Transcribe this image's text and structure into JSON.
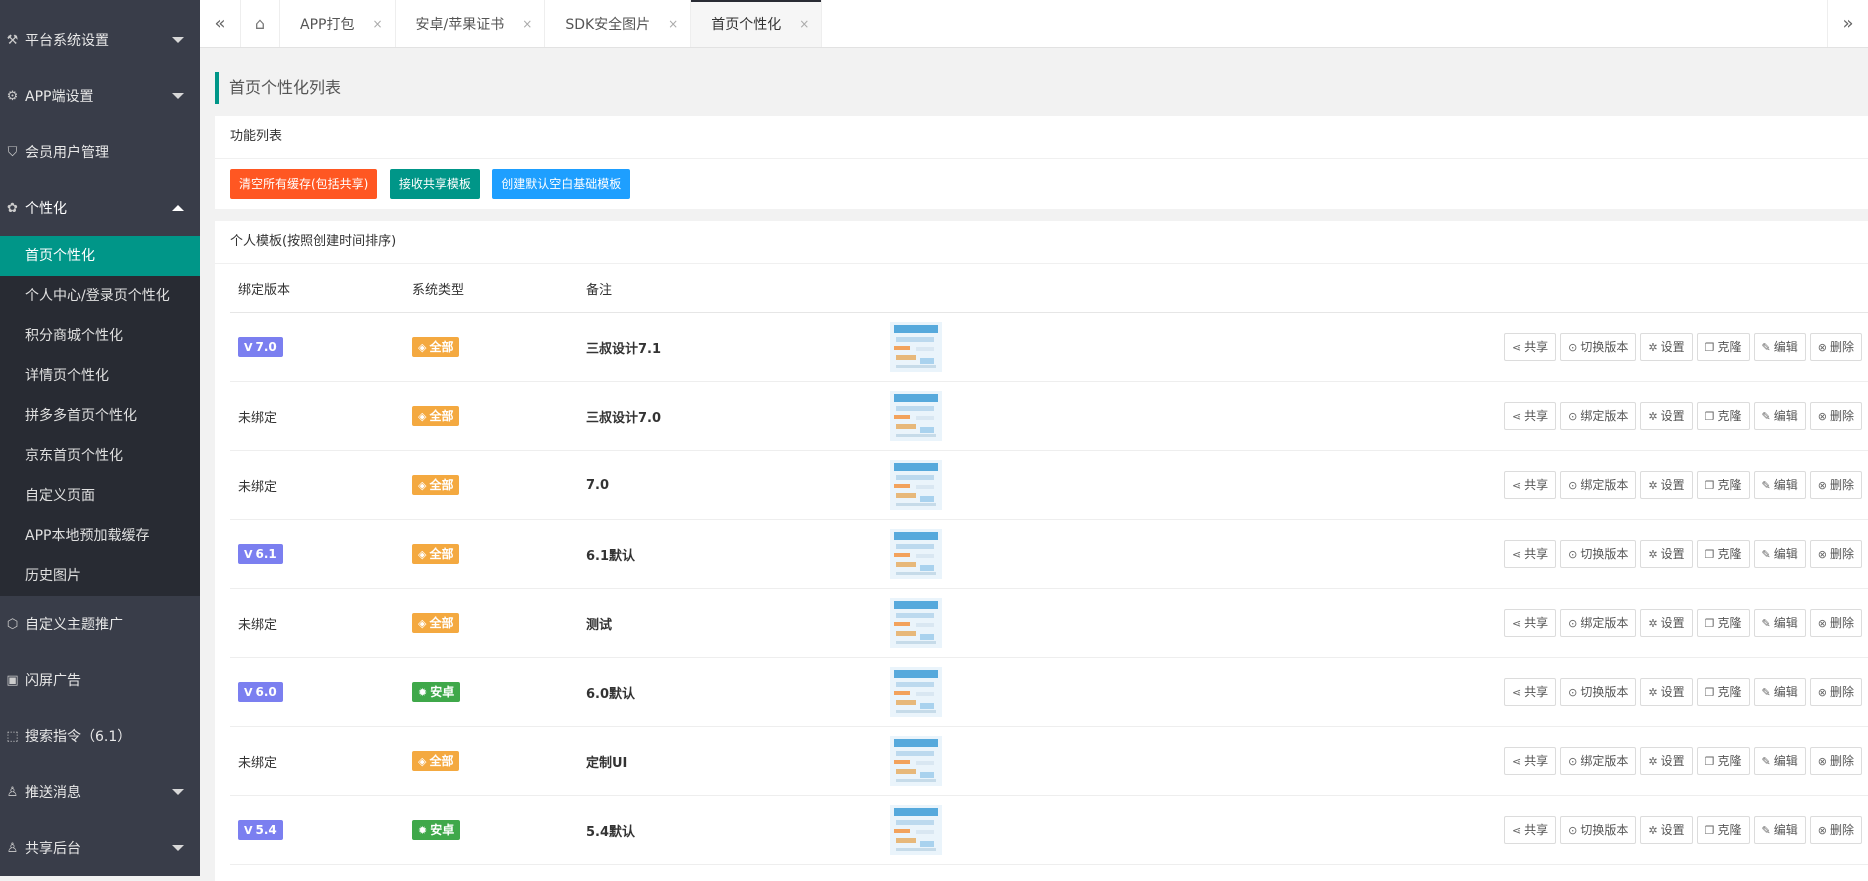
{
  "sidebar": {
    "items": [
      {
        "label": "平台系统设置",
        "icon": "tools-icon",
        "glyph": "⚒",
        "arrow": "down"
      },
      {
        "label": "APP端设置",
        "icon": "gear-icon",
        "glyph": "⚙",
        "arrow": "down"
      },
      {
        "label": "会员用户管理",
        "icon": "shield-icon",
        "glyph": "⛉",
        "arrow": ""
      },
      {
        "label": "个性化",
        "icon": "palette-icon",
        "glyph": "✿",
        "arrow": "up"
      }
    ],
    "subitems": [
      "首页个性化",
      "个人中心/登录页个性化",
      "积分商城个性化",
      "详情页个性化",
      "拼多多首页个性化",
      "京东首页个性化",
      "自定义页面",
      "APP本地预加载缓存",
      "历史图片"
    ],
    "bottom_items": [
      {
        "label": "自定义主题推广",
        "icon": "cube-icon",
        "glyph": "⬡",
        "arrow": ""
      },
      {
        "label": "闪屏广告",
        "icon": "image-icon",
        "glyph": "▣",
        "arrow": ""
      },
      {
        "label": "搜索指令（6.1）",
        "icon": "search-command-icon",
        "glyph": "⬚",
        "arrow": ""
      },
      {
        "label": "推送消息",
        "icon": "user-icon",
        "glyph": "♙",
        "arrow": "down"
      },
      {
        "label": "共享后台",
        "icon": "share-user-icon",
        "glyph": "♙",
        "arrow": "down"
      }
    ]
  },
  "tabs": [
    {
      "label": "APP打包"
    },
    {
      "label": "安卓/苹果证书"
    },
    {
      "label": "SDK安全图片"
    },
    {
      "label": "首页个性化"
    }
  ],
  "tab_close": "×",
  "page_title": "首页个性化列表",
  "functions": {
    "title": "功能列表",
    "buttons": [
      "清空所有缓存(包括共享)",
      "接收共享模板",
      "创建默认空白基础模板"
    ]
  },
  "templates": {
    "title": "个人模板(按照创建时间排序)",
    "columns": [
      "绑定版本",
      "系统类型",
      "备注"
    ],
    "rows": [
      {
        "version": "7.0",
        "system": "全部",
        "note": "三叔设计7.1",
        "switch": "切换版本"
      },
      {
        "version": "未绑定",
        "system": "全部",
        "note": "三叔设计7.0",
        "switch": "绑定版本"
      },
      {
        "version": "未绑定",
        "system": "全部",
        "note": "7.0",
        "switch": "绑定版本"
      },
      {
        "version": "6.1",
        "system": "全部",
        "note": "6.1默认",
        "switch": "切换版本"
      },
      {
        "version": "未绑定",
        "system": "全部",
        "note": "测试",
        "switch": "绑定版本"
      },
      {
        "version": "6.0",
        "system": "安卓",
        "note": "6.0默认",
        "switch": "切换版本"
      },
      {
        "version": "未绑定",
        "system": "全部",
        "note": "定制UI",
        "switch": "绑定版本"
      },
      {
        "version": "5.4",
        "system": "安卓",
        "note": "5.4默认",
        "switch": "切换版本"
      }
    ],
    "actions": {
      "share": "共享",
      "settings": "设置",
      "clone": "克隆",
      "edit": "编辑",
      "delete": "删除"
    }
  },
  "colors": {
    "sidebar_bg": "#393d49",
    "active_item": "#009688",
    "danger_button": "#ff5722",
    "normal_button": "#1e9fff",
    "version_badge": "#7b7ff0",
    "all_badge": "#f4a940",
    "android_badge": "#3fa84a"
  }
}
